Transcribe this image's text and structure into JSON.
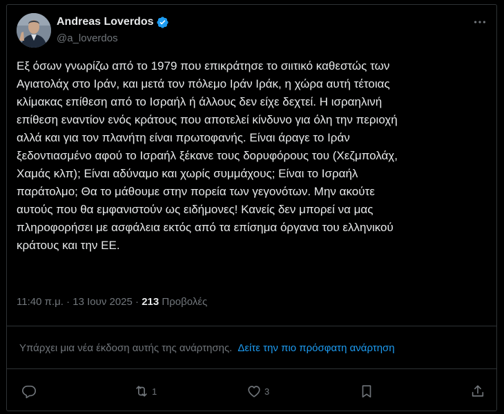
{
  "author": {
    "display_name": "Andreas Loverdos",
    "handle": "@a_loverdos",
    "verified": true,
    "avatar_icon": "avatar-portrait"
  },
  "tweet": {
    "text": "Εξ όσων γνωρίζω από το 1979 που επικράτησε το σιιτικό καθεστώς των\nΑγιατολάχ στο Ιράν, και μετά τον πόλεμο Ιράν Ιράκ, η χώρα αυτή τέτοιας\nκλίμακας επίθεση από το Ισραήλ ή άλλους δεν είχε δεχτεί. Η ισραηλινή\nεπίθεση εναντίον ενός κράτους που αποτελεί κίνδυνο για όλη την περιοχή\nαλλά και για τον πλανήτη είναι πρωτοφανής. Είναι άραγε το Ιράν\nξεδοντιασμένο αφού το Ισραήλ ξέκανε τους δορυφόρους του (Χεζμπολάχ,\nΧαμάς κλπ); Είναι αδύναμο και χωρίς συμμάχους; Είναι το Ισραήλ\nπαράτολμο; Θα το μάθουμε στην πορεία των γεγονότων. Μην ακούτε\nαυτούς που θα εμφανιστούν ως ειδήμονες! Κανείς δεν μπορεί να μας\nπληροφορήσει με ασφάλεια εκτός από τα επίσημα όργανα του ελληνικού\nκράτους και την ΕΕ.",
    "time": "11:40 π.μ.",
    "separator": "·",
    "date": "13 Ιουν 2025",
    "views_count": "213",
    "views_label": "Προβολές"
  },
  "notice": {
    "text": "Υπάρχει μια νέα έκδοση αυτής της ανάρτησης.",
    "link": "Δείτε την πιο πρόσφατη ανάρτηση"
  },
  "actions": {
    "reply_count": "",
    "repost_count": "1",
    "like_count": "3",
    "bookmark_count": "",
    "icons": [
      "reply-icon",
      "repost-icon",
      "like-icon",
      "bookmark-icon",
      "share-icon"
    ]
  },
  "colors": {
    "background": "#000000",
    "text": "#e7e9ea",
    "muted": "#71767b",
    "accent": "#1d9bf0",
    "border": "#2f3336"
  }
}
